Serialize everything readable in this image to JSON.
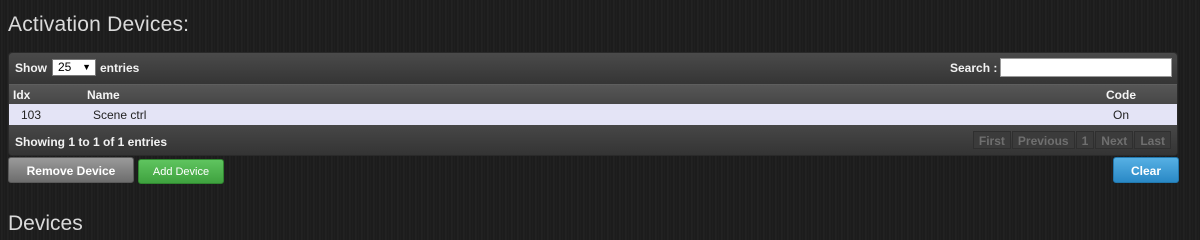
{
  "page": {
    "title": "Activation Devices:",
    "bottom_heading": "Devices"
  },
  "table_controls": {
    "show_label": "Show",
    "page_length": "25",
    "entries_label": "entries",
    "search_label": "Search :",
    "search_value": ""
  },
  "table": {
    "columns": [
      "Idx",
      "Name",
      "Code"
    ],
    "rows": [
      {
        "idx": "103",
        "name": "Scene ctrl",
        "code": "On"
      }
    ]
  },
  "footer": {
    "info": "Showing 1 to 1 of 1 entries",
    "pager": {
      "first": "First",
      "previous": "Previous",
      "page": "1",
      "next": "Next",
      "last": "Last"
    }
  },
  "buttons": {
    "remove": "Remove Device",
    "add": "Add Device",
    "clear": "Clear"
  },
  "colors": {
    "row_highlight": "#e4e4f6",
    "add_button": "#3fa23f",
    "clear_button": "#2a89c6",
    "remove_button": "#6d6d6d"
  },
  "icons": {
    "length_select": "chevron-down-icon"
  }
}
